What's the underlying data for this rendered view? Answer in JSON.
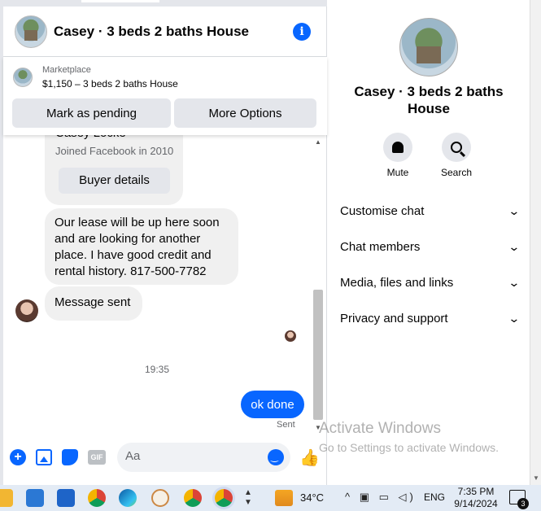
{
  "header": {
    "title": "Casey · 3 beds 2 baths House"
  },
  "marketplace": {
    "label": "Marketplace",
    "listing": "$1,150 – 3 beds 2 baths House",
    "pending_button": "Mark as pending",
    "more_button": "More Options"
  },
  "messages": {
    "buyer_name": "Casey Locke",
    "buyer_joined": "Joined Facebook in 2010",
    "buyer_details_button": "Buyer details",
    "lease_text": "Our lease will be up here soon and are looking for another place. I have good credit and rental history. 817-500-7782",
    "sent_text": "Message sent",
    "timestamp": "19:35",
    "my_message": "ok done",
    "status": "Sent"
  },
  "composer": {
    "placeholder": "Aa",
    "gif_label": "GIF"
  },
  "details": {
    "title": "Casey · 3 beds 2 baths House",
    "mute_label": "Mute",
    "search_label": "Search",
    "sections": [
      "Customise chat",
      "Chat members",
      "Media, files and links",
      "Privacy and support"
    ]
  },
  "watermark": {
    "line1": "Activate Windows",
    "line2": "Go to Settings to activate Windows."
  },
  "taskbar": {
    "temperature": "34°C",
    "language": "ENG",
    "time": "7:35 PM",
    "date": "9/14/2024",
    "notification_count": "3"
  }
}
